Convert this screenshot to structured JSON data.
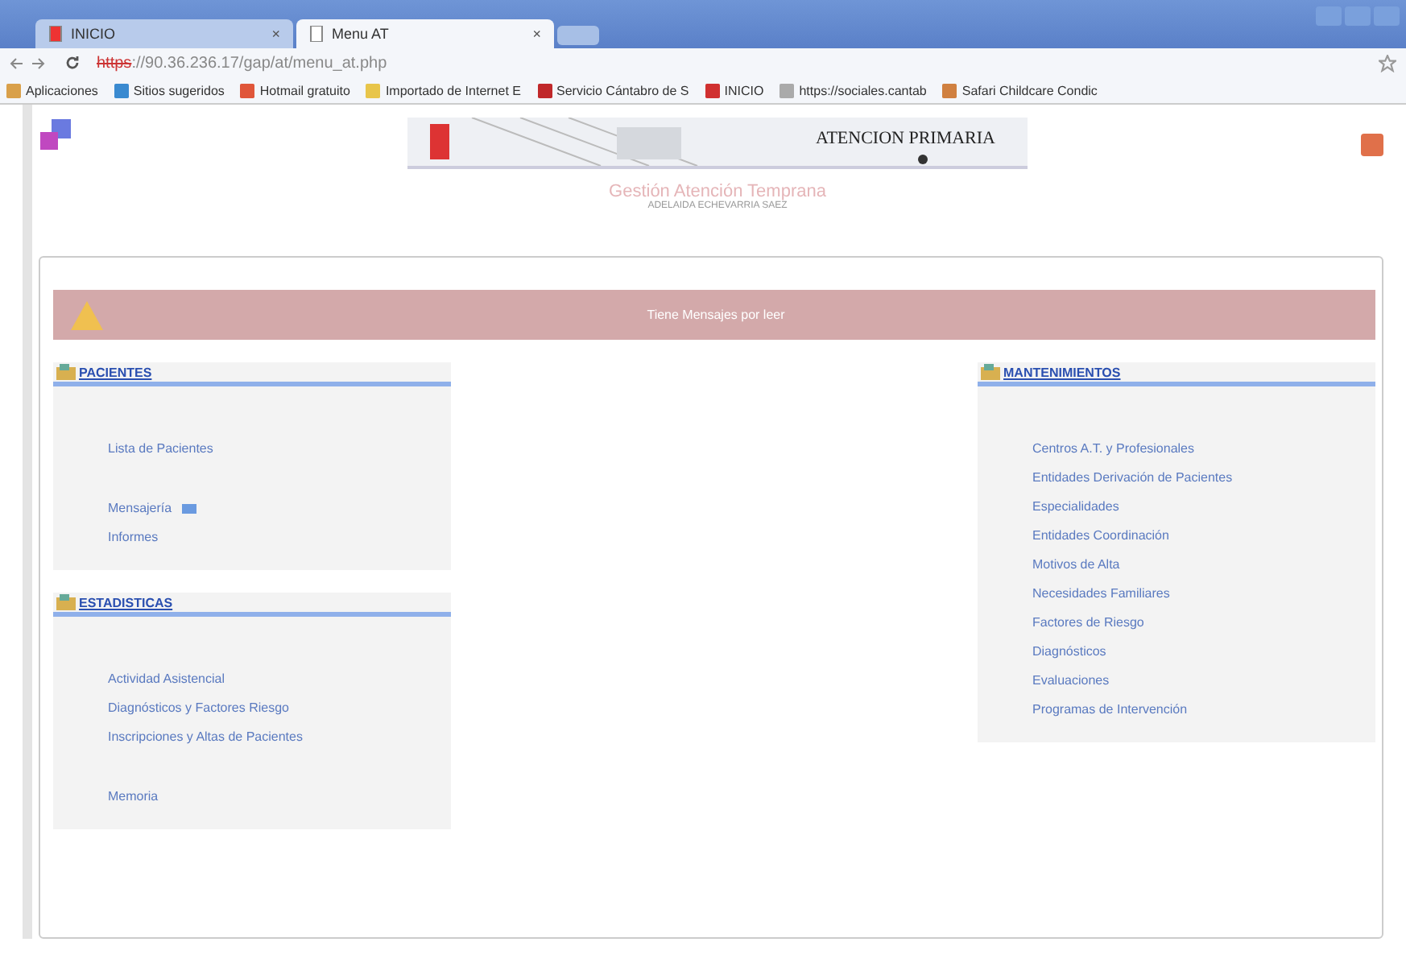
{
  "browser": {
    "tabs": [
      {
        "title": "INICIO",
        "close": "×",
        "selected": false
      },
      {
        "title": "Menu AT",
        "close": "×",
        "selected": true
      }
    ],
    "address": {
      "scheme": "https",
      "rest": "://90.36.236.17/gap/at/menu_at.php"
    },
    "bookmarks": [
      "Aplicaciones",
      "Sitios sugeridos",
      "Hotmail gratuito",
      "Importado de Internet E",
      "Servicio Cántabro de S",
      "INICIO",
      "https://sociales.cantab",
      "Safari Childcare Condic"
    ]
  },
  "header": {
    "banner": "ATENCION PRIMARIA",
    "title": "Gestión Atención Temprana",
    "user": "ADELAIDA ECHEVARRIA SAEZ"
  },
  "alert": "Tiene Mensajes por leer",
  "left_column": [
    {
      "title": "PACIENTES",
      "groups": [
        [
          {
            "label": "Lista de Pacientes",
            "unread": false
          }
        ],
        [
          {
            "label": "Mensajería",
            "unread": true
          },
          {
            "label": "Informes",
            "unread": false
          }
        ]
      ]
    },
    {
      "title": "ESTADISTICAS",
      "groups": [
        [
          {
            "label": "Actividad Asistencial",
            "unread": false
          },
          {
            "label": "Diagnósticos y Factores Riesgo",
            "unread": false
          },
          {
            "label": "Inscripciones y Altas de Pacientes",
            "unread": false
          }
        ],
        [
          {
            "label": "Memoria",
            "unread": false
          }
        ]
      ]
    }
  ],
  "right_column": [
    {
      "title": "MANTENIMIENTOS",
      "groups": [
        [
          {
            "label": "Centros A.T. y Profesionales",
            "unread": false
          },
          {
            "label": "Entidades Derivación de Pacientes",
            "unread": false
          },
          {
            "label": "Especialidades",
            "unread": false
          },
          {
            "label": "Entidades Coordinación",
            "unread": false
          },
          {
            "label": "Motivos de Alta",
            "unread": false
          },
          {
            "label": "Necesidades Familiares",
            "unread": false
          },
          {
            "label": "Factores de Riesgo",
            "unread": false
          },
          {
            "label": "Diagnósticos",
            "unread": false
          },
          {
            "label": "Evaluaciones",
            "unread": false
          },
          {
            "label": "Programas de Intervención",
            "unread": false
          }
        ]
      ]
    }
  ]
}
